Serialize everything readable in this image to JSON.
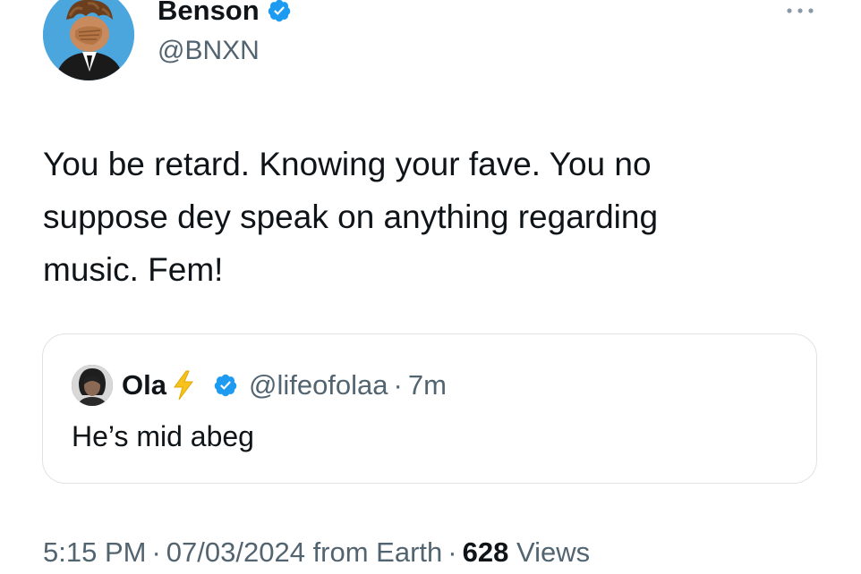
{
  "tweet": {
    "author": {
      "name": "Benson",
      "handle": "@BNXN",
      "verified_color": "#1d9bf0",
      "avatar_bg": "#4aa6dd"
    },
    "text": "You be retard. Knowing your fave. You no\nsuppose dey speak on anything regarding\nmusic. Fem!",
    "more_icon": "more-horizontal-icon",
    "quote": {
      "name": "Ola",
      "emoji_icon": "lightning-bolt-icon",
      "handle": "@lifeofolaa",
      "dot": "·",
      "time": "7m",
      "text": "He’s mid abeg"
    },
    "meta": {
      "time": "5:15 PM",
      "date": "07/03/2024",
      "source": "from Earth",
      "views_count": "628",
      "views_label": "Views",
      "dot": "·"
    }
  }
}
